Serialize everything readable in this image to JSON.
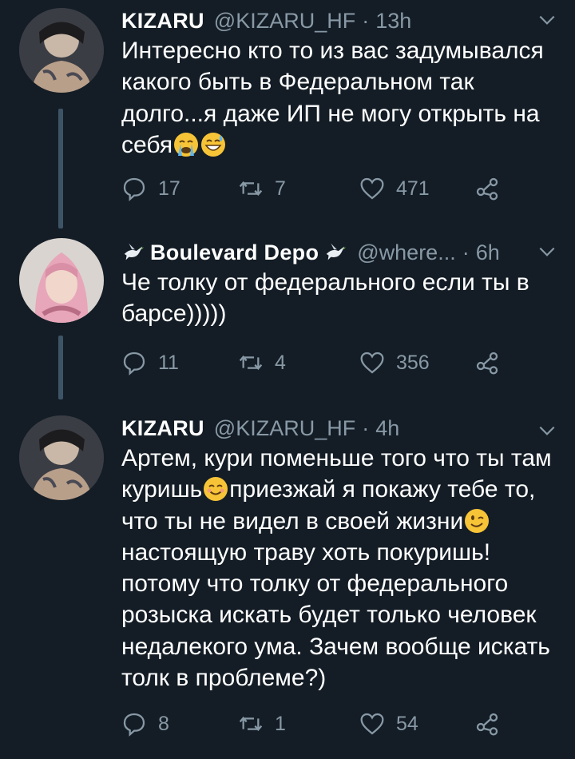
{
  "tweets": [
    {
      "name": "KIZARU",
      "handle": "@KIZARU_HF",
      "separator": "·",
      "time": "13h",
      "text_segments": [
        "Интересно кто то из вас задумывался какого быть в Федеральном так долго...я даже ИП не могу открыть на себя"
      ],
      "emojis": [
        "loudly-crying-face",
        "grinning-sweat-face"
      ],
      "replies": "17",
      "retweets": "7",
      "likes": "471"
    },
    {
      "name": "Boulevard Depo",
      "handle": "@where...",
      "separator": "·",
      "time": "6h",
      "name_badges": [
        "dove-emoji",
        "dove-emoji"
      ],
      "text": "Че толку от федерального если ты в барсе)))))",
      "replies": "11",
      "retweets": "4",
      "likes": "356"
    },
    {
      "name": "KIZARU",
      "handle": "@KIZARU_HF",
      "separator": "·",
      "time": "4h",
      "text_segments": [
        "Артем, кури поменьше того что ты там куришь",
        "приезжай я покажу тебе то, что ты не видел в своей жизни",
        "настоящую траву хоть покуришь! потому что толку от федерального розыска искать будет только человек недалекого ума. Зачем вообще искать толк в проблеме?)"
      ],
      "emojis": [
        "smiling-face",
        "winking-face"
      ],
      "replies": "8",
      "retweets": "1",
      "likes": "54"
    }
  ],
  "colors": {
    "background": "#141d26",
    "secondary_text": "#8899a6",
    "thread_line": "#3d5466"
  }
}
